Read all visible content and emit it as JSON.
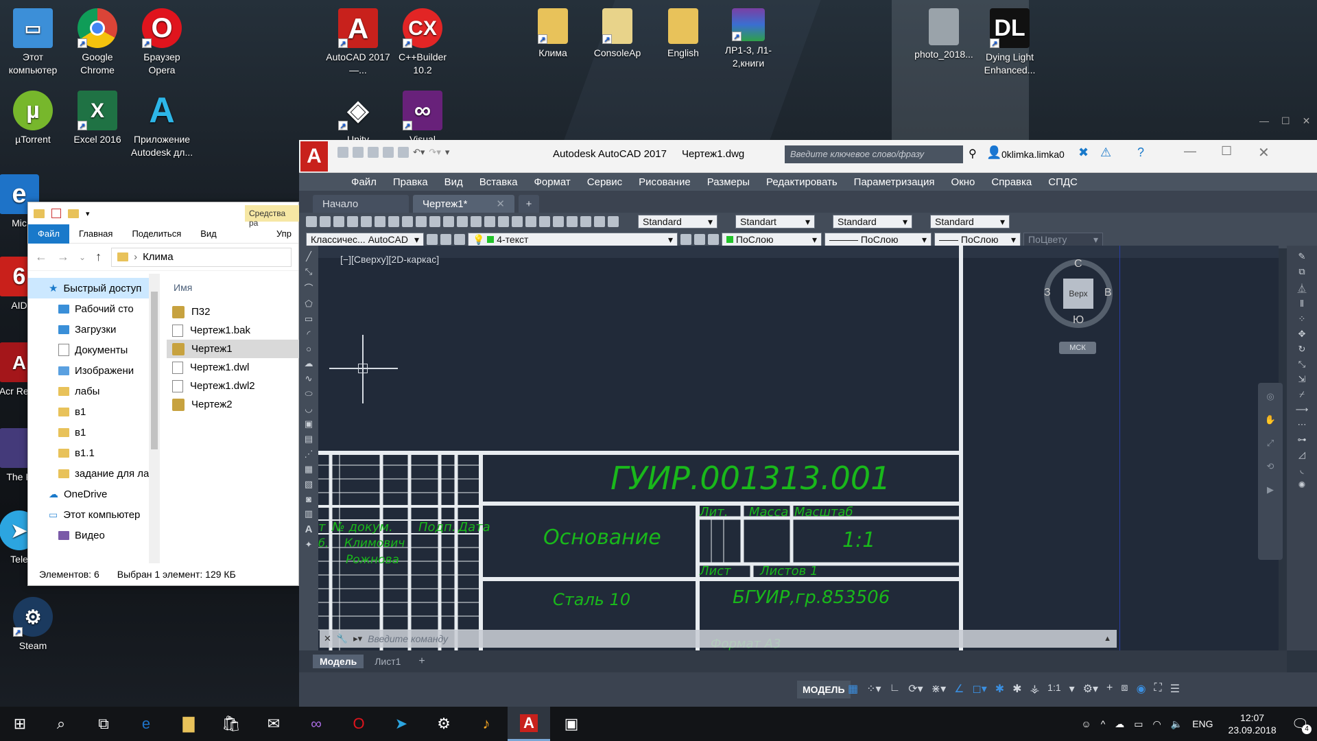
{
  "desktop": {
    "icons": [
      {
        "label": "Этот компьютер"
      },
      {
        "label": "Google Chrome"
      },
      {
        "label": "Браузер Opera"
      },
      {
        "label": "AutoCAD 2017 —..."
      },
      {
        "label": "C++Builder 10.2"
      },
      {
        "label": "Клима"
      },
      {
        "label": "ConsoleAp"
      },
      {
        "label": "English"
      },
      {
        "label": "ЛР1-3, Л1-2,книги"
      },
      {
        "label": "photo_2018..."
      },
      {
        "label": "Dying Light Enhanced..."
      },
      {
        "label": "µTorrent"
      },
      {
        "label": "Excel 2016"
      },
      {
        "label": "Приложение Autodesk дл..."
      },
      {
        "label": "Unity"
      },
      {
        "label": "Visual"
      },
      {
        "label": "Mic"
      },
      {
        "label": "AID"
      },
      {
        "label": "Acr Read"
      },
      {
        "label": "The K"
      },
      {
        "label": "Tele"
      },
      {
        "label": "Steam"
      }
    ]
  },
  "explorer": {
    "ribbon_context": "Средства ра",
    "ribbon_tabs": [
      "Файл",
      "Главная",
      "Поделиться",
      "Вид",
      "Упр"
    ],
    "path": "Клима",
    "column_name": "Имя",
    "nav": [
      {
        "label": "Быстрый доступ"
      },
      {
        "label": "Рабочий сто"
      },
      {
        "label": "Загрузки"
      },
      {
        "label": "Документы"
      },
      {
        "label": "Изображени"
      },
      {
        "label": "лабы"
      },
      {
        "label": "в1"
      },
      {
        "label": "в1"
      },
      {
        "label": "в1.1"
      },
      {
        "label": "задание для лаб"
      },
      {
        "label": "OneDrive"
      },
      {
        "label": "Этот компьютер"
      },
      {
        "label": "Видео"
      }
    ],
    "files": [
      {
        "name": "П32"
      },
      {
        "name": "Чертеж1.bak"
      },
      {
        "name": "Чертеж1"
      },
      {
        "name": "Чертеж1.dwl"
      },
      {
        "name": "Чертеж1.dwl2"
      },
      {
        "name": "Чертеж2"
      }
    ],
    "status_count": "Элементов: 6",
    "status_selection": "Выбран 1 элемент: 129 КБ"
  },
  "acad": {
    "app_title": "Autodesk AutoCAD 2017",
    "file_title": "Чертеж1.dwg",
    "search_placeholder": "Введите ключевое слово/фразу",
    "user": "0klimka.limka0",
    "menu": [
      "Файл",
      "Правка",
      "Вид",
      "Вставка",
      "Формат",
      "Сервис",
      "Рисование",
      "Размеры",
      "Редактировать",
      "Параметризация",
      "Окно",
      "Справка",
      "СПДС"
    ],
    "tabs": [
      "Начало",
      "Чертеж1*"
    ],
    "styles": [
      "Standard",
      "Standart",
      "Standard",
      "Standard"
    ],
    "workspace": "Классичес... AutoCAD",
    "layer": "4-текст",
    "props": [
      "ПоСлою",
      "ПоСлою",
      "ПоСлою",
      "ПоЦвету"
    ],
    "viewport_label": "[−][Сверху][2D-каркас]",
    "viewcube": {
      "top": "С",
      "bottom": "Ю",
      "left": "З",
      "right": "В",
      "face": "Верх",
      "ucs": "МСК"
    },
    "drawing": {
      "code": "ГУИР.001313.001",
      "basis": "Основание",
      "material": "Сталь 10",
      "org": "БГУИР,гр.853506",
      "lit": "Лит.",
      "mass": "Масса",
      "scale_hdr": "Масштаб",
      "scale_val": "1:1",
      "sheet": "Лист",
      "sheets": "Листов 1",
      "h_izm": "т",
      "h_doc": "№ докум.",
      "h_sign": "Подп.",
      "h_date": "Дата",
      "row1_a": "б.",
      "name1": "Климович",
      "name2": "Рожнова",
      "format": "Формат А3"
    },
    "command_placeholder": "Введите команду",
    "layout_tabs": [
      "Модель",
      "Лист1"
    ],
    "status_mode": "МОДЕЛЬ",
    "status_scale": "1:1"
  },
  "taskbar": {
    "lang": "ENG",
    "time": "12:07",
    "date": "23.09.2018",
    "notif": "4"
  }
}
